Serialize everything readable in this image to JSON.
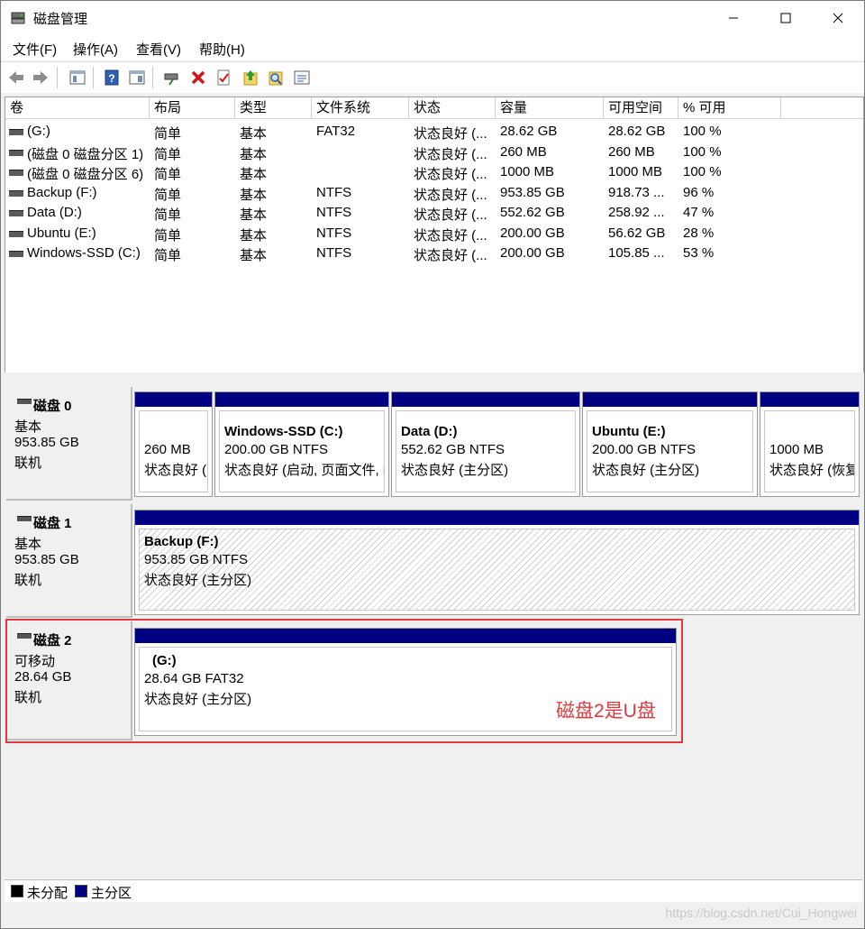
{
  "window": {
    "title": "磁盘管理",
    "controls": [
      "minimize",
      "maximize",
      "close"
    ]
  },
  "menu": [
    "文件(F)",
    "操作(A)",
    "查看(V)",
    "帮助(H)"
  ],
  "toolbar_icons": [
    "back-icon",
    "forward-icon",
    "console-tree-icon",
    "help-icon",
    "properties-view-icon",
    "connect-disk-icon",
    "delete-icon",
    "check-icon",
    "export-icon",
    "search-icon",
    "options-icon"
  ],
  "volume_list": {
    "columns": [
      "卷",
      "布局",
      "类型",
      "文件系统",
      "状态",
      "容量",
      "可用空间",
      "% 可用"
    ],
    "rows": [
      [
        "(G:)",
        "简单",
        "基本",
        "FAT32",
        "状态良好 (...",
        "28.62 GB",
        "28.62 GB",
        "100 %"
      ],
      [
        "(磁盘 0 磁盘分区 1)",
        "简单",
        "基本",
        "",
        "状态良好 (...",
        "260 MB",
        "260 MB",
        "100 %"
      ],
      [
        "(磁盘 0 磁盘分区 6)",
        "简单",
        "基本",
        "",
        "状态良好 (...",
        "1000 MB",
        "1000 MB",
        "100 %"
      ],
      [
        "Backup (F:)",
        "简单",
        "基本",
        "NTFS",
        "状态良好 (...",
        "953.85 GB",
        "918.73 ...",
        "96 %"
      ],
      [
        "Data (D:)",
        "简单",
        "基本",
        "NTFS",
        "状态良好 (...",
        "552.62 GB",
        "258.92 ...",
        "47 %"
      ],
      [
        "Ubuntu (E:)",
        "简单",
        "基本",
        "NTFS",
        "状态良好 (...",
        "200.00 GB",
        "56.62 GB",
        "28 %"
      ],
      [
        "Windows-SSD (C:)",
        "简单",
        "基本",
        "NTFS",
        "状态良好 (...",
        "200.00 GB",
        "105.85 ...",
        "53 %"
      ]
    ]
  },
  "disks": [
    {
      "name": "磁盘 0",
      "type": "基本",
      "size": "953.85 GB",
      "status": "联机",
      "partitions": [
        {
          "title": "",
          "size": "260 MB",
          "status": "状态良好 (",
          "selected": false
        },
        {
          "title": "Windows-SSD  (C:)",
          "size": "200.00 GB NTFS",
          "status": "状态良好 (启动, 页面文件, i",
          "selected": false
        },
        {
          "title": "Data  (D:)",
          "size": "552.62 GB NTFS",
          "status": "状态良好 (主分区)",
          "selected": false
        },
        {
          "title": "Ubuntu  (E:)",
          "size": "200.00 GB NTFS",
          "status": "状态良好 (主分区)",
          "selected": false
        },
        {
          "title": "",
          "size": "1000 MB",
          "status": "状态良好 (恢复",
          "selected": false
        }
      ]
    },
    {
      "name": "磁盘 1",
      "type": "基本",
      "size": "953.85 GB",
      "status": "联机",
      "partitions": [
        {
          "title": "Backup  (F:)",
          "size": "953.85 GB NTFS",
          "status": "状态良好 (主分区)",
          "selected": true
        }
      ]
    },
    {
      "name": "磁盘 2",
      "type": "可移动",
      "size": "28.64 GB",
      "status": "联机",
      "partitions": [
        {
          "title": "(G:)",
          "size": "28.64 GB FAT32",
          "status": "状态良好 (主分区)",
          "selected": false
        }
      ]
    }
  ],
  "annotation": "磁盘2是U盘",
  "legend": [
    {
      "label": "未分配",
      "color": "#000000"
    },
    {
      "label": "主分区",
      "color": "#000080"
    }
  ],
  "watermark": "https://blog.csdn.net/Cui_Hongwei"
}
